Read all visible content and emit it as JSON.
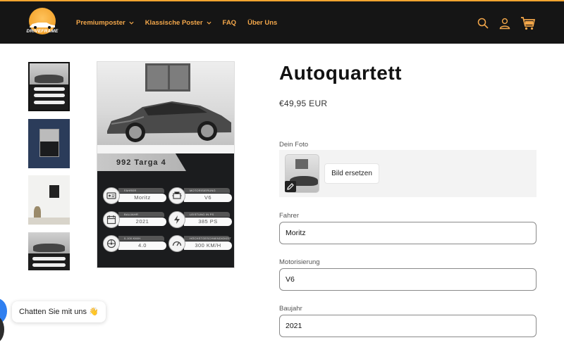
{
  "header": {
    "logo_text": "DRIVEFRAME",
    "nav": [
      {
        "label": "Premiumposter",
        "has_dropdown": true
      },
      {
        "label": "Klassische Poster",
        "has_dropdown": true
      },
      {
        "label": "FAQ",
        "has_dropdown": false
      },
      {
        "label": "Über Uns",
        "has_dropdown": false
      }
    ],
    "icons": [
      "search-icon",
      "account-icon",
      "cart-icon"
    ]
  },
  "poster": {
    "name": "992 Targa 4",
    "stats": [
      {
        "label": "FAHRER",
        "value": "Moritz",
        "icon": "id-card-icon"
      },
      {
        "label": "MOTORISIERUNG",
        "value": "V6",
        "icon": "engine-icon"
      },
      {
        "label": "BAUJAHR",
        "value": "2021",
        "icon": "calendar-icon"
      },
      {
        "label": "LEISTUNG IN PS",
        "value": "385 PS",
        "icon": "power-icon"
      },
      {
        "label": "0-100 KM/H",
        "value": "4.0",
        "icon": "wheel-icon"
      },
      {
        "label": "HÖCHSTGESCHWINDIGKEIT",
        "value": "300 KM/H",
        "icon": "speedometer-icon"
      }
    ]
  },
  "product": {
    "title": "Autoquartett",
    "price": "€49,95 EUR",
    "photo_label": "Dein Foto",
    "replace_button": "Bild ersetzen",
    "fields": [
      {
        "label": "Fahrer",
        "value": "Moritz"
      },
      {
        "label": "Motorisierung",
        "value": "V6"
      },
      {
        "label": "Baujahr",
        "value": "2021"
      }
    ]
  },
  "chat": {
    "label": "Chatten Sie mit uns 👋"
  },
  "colors": {
    "header_bg": "#151515",
    "accent": "#f1a430",
    "nav_text": "#f3a74a"
  }
}
